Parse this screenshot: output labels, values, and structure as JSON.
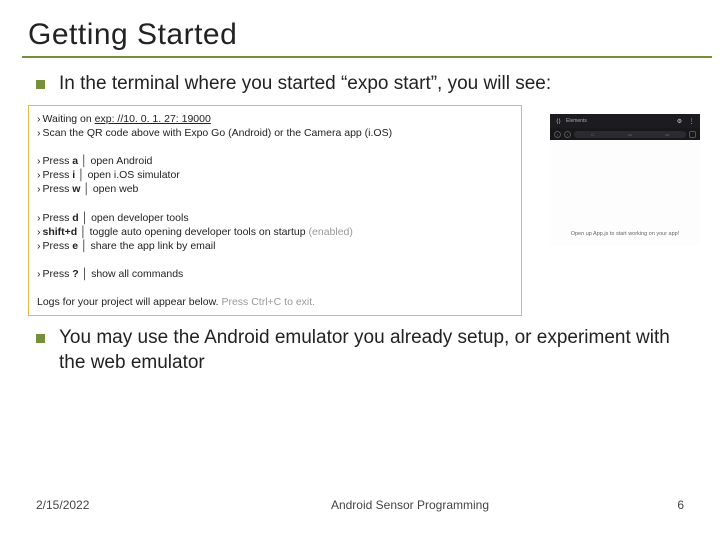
{
  "title": "Getting Started",
  "bullet1": "In the terminal where you started “expo start”, you will see:",
  "terminal": {
    "block1": {
      "l1_pre": "Waiting on ",
      "l1_url": "exp: //10. 0. 1. 27: 19000",
      "l2": "Scan the QR code above with Expo Go (Android) or the Camera app (i.OS)"
    },
    "block2": {
      "l1_a": "Press ",
      "l1_b": "a",
      "l1_c": " │ open Android",
      "l2_a": "Press ",
      "l2_b": "i",
      "l2_c": " │ open i.OS simulator",
      "l3_a": "Press ",
      "l3_b": "w",
      "l3_c": " │ open web"
    },
    "block3": {
      "l1_a": "Press ",
      "l1_b": "d",
      "l1_c": " │ open developer tools",
      "l2_a": "",
      "l2_b": "shift+d",
      "l2_c": " │ toggle auto opening developer tools on startup ",
      "l2_d": "(enabled)",
      "l3_a": "Press ",
      "l3_b": "e",
      "l3_c": " │ share the app link by email"
    },
    "block4": {
      "l1_a": "Press ",
      "l1_b": "?",
      "l1_c": " │ show all commands"
    },
    "logs_a": "Logs for your project will appear below. ",
    "logs_b": "Press Ctrl+C to exit."
  },
  "bullet2": "You may use the Android emulator you already setup, or experiment with the web emulator",
  "footer": {
    "date": "2/15/2022",
    "title": "Android Sensor Programming",
    "page": "6"
  },
  "screenshot": {
    "hint": "Open up App.js to start working on your app!"
  }
}
